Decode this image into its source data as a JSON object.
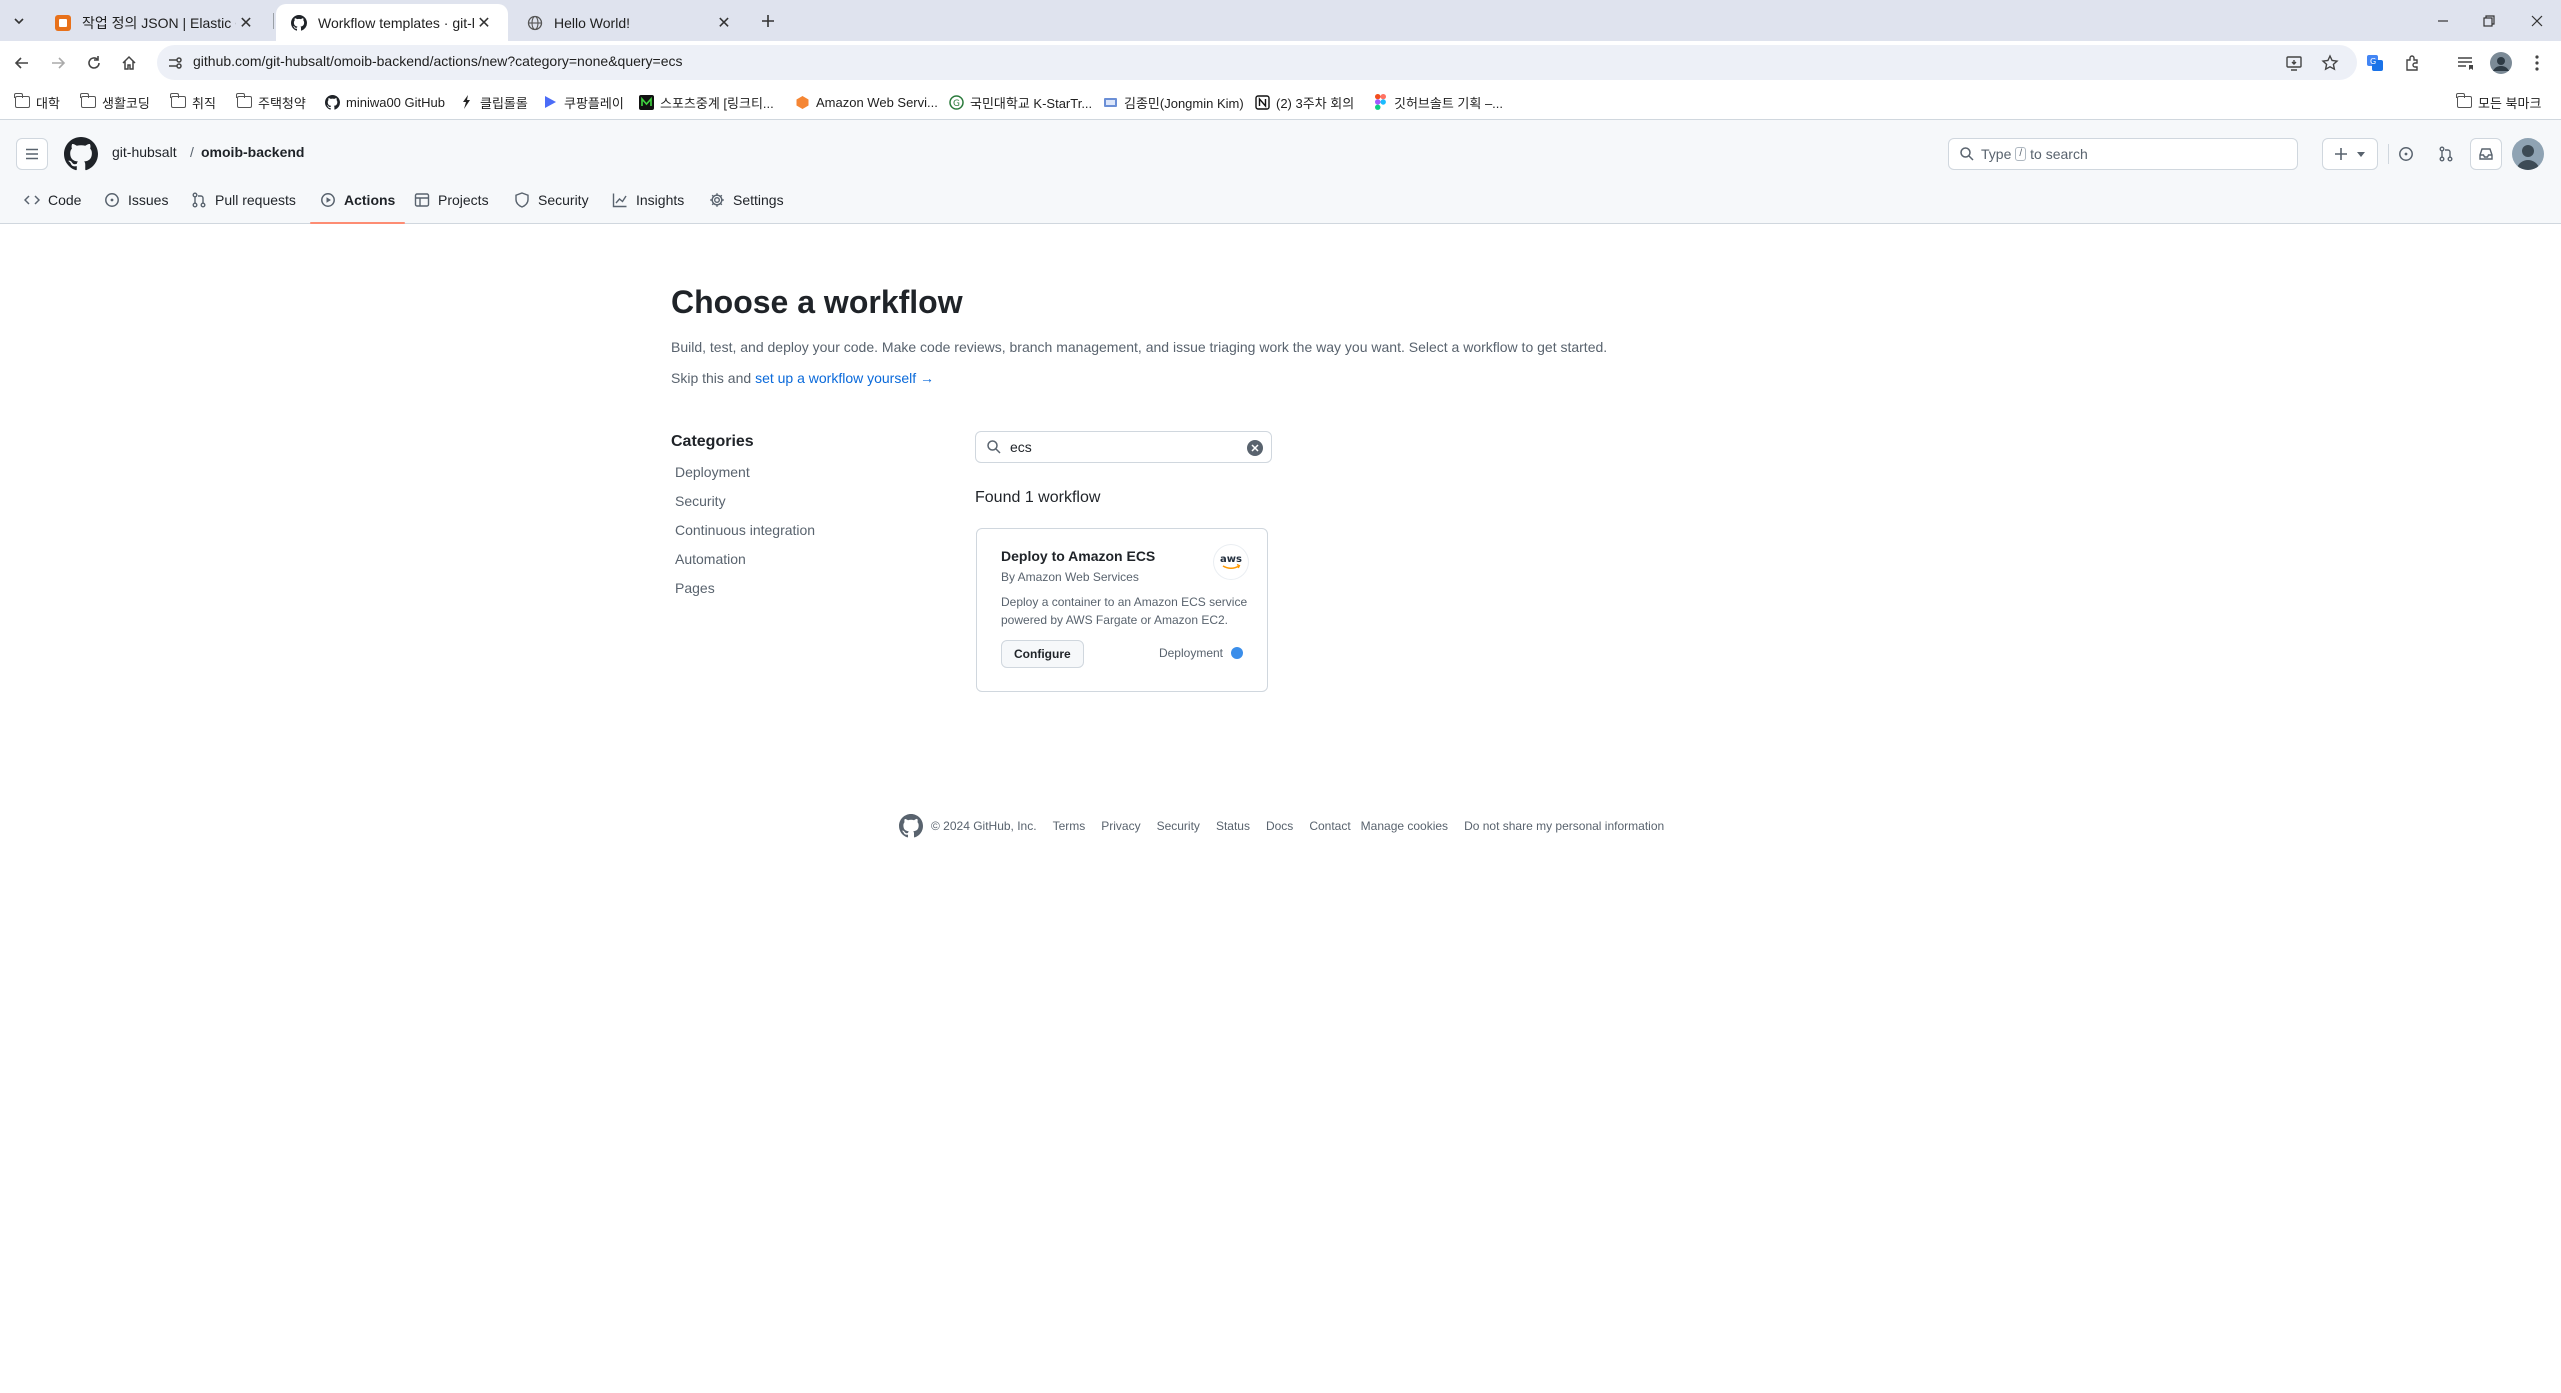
{
  "browser": {
    "tabs": [
      {
        "title": "작업 정의 JSON | Elastic Conta",
        "active": false
      },
      {
        "title": "Workflow templates · git-hubs",
        "active": true
      },
      {
        "title": "Hello World!",
        "active": false
      }
    ],
    "url": "github.com/git-hubsalt/omoib-backend/actions/new?category=none&query=ecs",
    "bookmarks": [
      {
        "label": "대학",
        "icon": "folder-icon"
      },
      {
        "label": "생활코딩",
        "icon": "folder-icon"
      },
      {
        "label": "취직",
        "icon": "folder-icon"
      },
      {
        "label": "주택청약",
        "icon": "folder-icon"
      },
      {
        "label": "miniwa00 GitHub",
        "icon": "github-icon"
      },
      {
        "label": "클립롤롤",
        "icon": "clip-icon"
      },
      {
        "label": "쿠팡플레이",
        "icon": "play-icon"
      },
      {
        "label": "스포츠중계 [링크티...",
        "icon": "site-icon"
      },
      {
        "label": "Amazon Web Servi...",
        "icon": "aws-icon"
      },
      {
        "label": "국민대학교 K-StarTr...",
        "icon": "site-icon"
      },
      {
        "label": "김종민(Jongmin Kim)",
        "icon": "site-icon"
      },
      {
        "label": "(2) 3주차 회의",
        "icon": "notion-icon"
      },
      {
        "label": "깃허브솔트 기획 –...",
        "icon": "figma-icon"
      }
    ],
    "other_bookmarks": "모든 북마크"
  },
  "header": {
    "owner": "git-hubsalt",
    "separator": "/",
    "repo": "omoib-backend",
    "search_prefix": "Type",
    "search_key": "/",
    "search_suffix": "to search"
  },
  "repo_nav": [
    {
      "label": "Code",
      "icon": "code-icon"
    },
    {
      "label": "Issues",
      "icon": "issue-icon"
    },
    {
      "label": "Pull requests",
      "icon": "pull-request-icon"
    },
    {
      "label": "Actions",
      "icon": "play-icon",
      "selected": true
    },
    {
      "label": "Projects",
      "icon": "table-icon"
    },
    {
      "label": "Security",
      "icon": "shield-icon"
    },
    {
      "label": "Insights",
      "icon": "graph-icon"
    },
    {
      "label": "Settings",
      "icon": "gear-icon"
    }
  ],
  "main": {
    "title": "Choose a workflow",
    "lead": "Build, test, and deploy your code. Make code reviews, branch management, and issue triaging work the way you want. Select a workflow to get started.",
    "skip_prefix": "Skip this and",
    "skip_link": "set up a workflow yourself",
    "skip_arrow": "→",
    "categories_heading": "Categories",
    "categories": [
      "Deployment",
      "Security",
      "Continuous integration",
      "Automation",
      "Pages"
    ],
    "search_value": "ecs",
    "found_text": "Found 1 workflow",
    "workflow": {
      "title": "Deploy to Amazon ECS",
      "by": "By Amazon Web Services",
      "description": "Deploy a container to an Amazon ECS service powered by AWS Fargate or Amazon EC2.",
      "logo_text": "aws",
      "configure_label": "Configure",
      "category": "Deployment",
      "category_color": "#3b8eea"
    }
  },
  "footer": {
    "copyright": "© 2024 GitHub, Inc.",
    "links": [
      "Terms",
      "Privacy",
      "Security",
      "Status",
      "Docs",
      "Contact",
      "Manage cookies",
      "Do not share my personal information"
    ]
  },
  "colors": {
    "accent_link": "#0969da",
    "selected_underline": "#fd8c73",
    "header_bg": "#f6f8fa"
  }
}
